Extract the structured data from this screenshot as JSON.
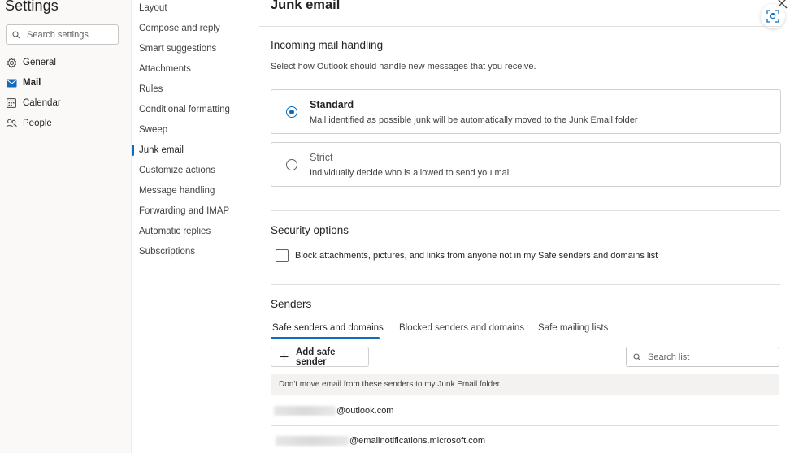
{
  "app": {
    "title": "Settings"
  },
  "search": {
    "placeholder": "Search settings"
  },
  "nav": {
    "items": [
      {
        "label": "General",
        "icon": "gear-icon"
      },
      {
        "label": "Mail",
        "icon": "mail-icon",
        "active": true
      },
      {
        "label": "Calendar",
        "icon": "calendar-icon"
      },
      {
        "label": "People",
        "icon": "people-icon"
      }
    ]
  },
  "mail_menu": {
    "items": [
      "Layout",
      "Compose and reply",
      "Smart suggestions",
      "Attachments",
      "Rules",
      "Conditional formatting",
      "Sweep",
      "Junk email",
      "Customize actions",
      "Message handling",
      "Forwarding and IMAP",
      "Automatic replies",
      "Subscriptions"
    ],
    "active": "Junk email"
  },
  "main": {
    "title": "Junk email",
    "incoming": {
      "heading": "Incoming mail handling",
      "description": "Select how Outlook should handle new messages that you receive.",
      "options": [
        {
          "title": "Standard",
          "description": "Mail identified as possible junk will be automatically moved to the Junk Email folder",
          "selected": true
        },
        {
          "title": "Strict",
          "description": "Individually decide who is allowed to send you mail",
          "selected": false
        }
      ]
    },
    "security": {
      "heading": "Security options",
      "checkbox_label": "Block attachments, pictures, and links from anyone not in my Safe senders and domains list",
      "checked": false
    },
    "senders": {
      "heading": "Senders",
      "tabs": [
        "Safe senders and domains",
        "Blocked senders and domains",
        "Safe mailing lists"
      ],
      "active_tab": "Safe senders and domains",
      "add_button": "Add safe sender",
      "search_placeholder": "Search list",
      "list_header": "Don't move email from these senders to my Junk Email folder.",
      "rows": [
        {
          "domain": "@outlook.com"
        },
        {
          "domain": "@emailnotifications.microsoft.com"
        }
      ]
    }
  },
  "colors": {
    "accent": "#0f6cbd"
  }
}
